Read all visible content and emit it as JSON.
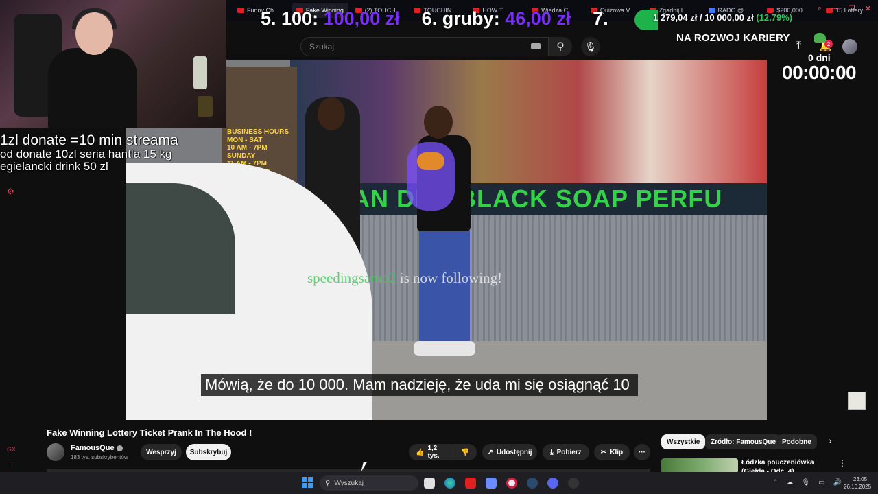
{
  "browser": {
    "tabs": [
      {
        "label": "Funny Ch",
        "active": false
      },
      {
        "label": "Fake Winning",
        "active": true
      },
      {
        "label": "(2) TOUCH",
        "active": false
      },
      {
        "label": "TOUCHIN",
        "active": false
      },
      {
        "label": "HOW T",
        "active": false
      },
      {
        "label": "Wiedza C",
        "active": false
      },
      {
        "label": "Quizowa V",
        "active": false
      },
      {
        "label": "Zgadnij L",
        "active": false
      },
      {
        "label": "RADO @",
        "active": false
      },
      {
        "label": "$200,000",
        "active": false
      },
      {
        "label": "15 Lottery",
        "active": false
      }
    ]
  },
  "stream_overlay": {
    "donate_line1": "1zl donate =10 min streama",
    "donate_line2": "od donate 10zl seria hantla 15 kg",
    "donate_line3": "egielancki drink 50 zl",
    "stat1_label": "5. 100:",
    "stat1_value": "100,00 zł",
    "stat2_label": "6. gruby:",
    "stat2_value": "46,00 zł",
    "stat3_label": "7.",
    "lottery_current": "1 279,04 zł",
    "lottery_sep": " / ",
    "lottery_goal": "10 000,00 zł",
    "lottery_pct": "(12.79%)",
    "lottery_progress": 0.1279,
    "career_title": "NA ROZWOJ KARIERY",
    "days_label": "0 dni",
    "timer": "00:00:00"
  },
  "youtube": {
    "search_placeholder": "Szukaj",
    "notification_count": "2",
    "video_title": "Fake Winning Lottery Ticket Prank In The Hood !",
    "channel_name": "FamousQue",
    "subscriber_count": "183 tys. subskrybentów",
    "support_label": "Wesprzyj",
    "subscribe_label": "Subskrybuj",
    "like_count": "1,2 tys.",
    "share_label": "Udostępnij",
    "download_label": "Pobierz",
    "clip_label": "Klip",
    "more_label": "···",
    "chips": [
      "Wszystkie",
      "Źródło: FamousQue",
      "Podobne"
    ],
    "related_title": "Łódzka pouczeniówka (Giełda - Odc. 4)"
  },
  "video": {
    "store_sign": "AN DRE   BLACK SOAP  PERFU",
    "store_hours": "BUSINESS HOURS\nMON - SAT\n10 AM - 7PM\nSUNDAY\n11 AM - 7PM\n404-765-9690",
    "follow_user": "speedingsamo2",
    "follow_text": " is now following!",
    "subtitle": "Mówią, że do 10 000.  Mam nadzieję, że uda mi się osiągnąć 10"
  },
  "taskbar": {
    "search_placeholder": "Wyszukaj",
    "time": "23:05",
    "date": "26.10.2025"
  },
  "icons": {
    "accent_purple": "#7a2dff",
    "accent_green": "#1fd05a",
    "youtube_red": "#e02020"
  }
}
